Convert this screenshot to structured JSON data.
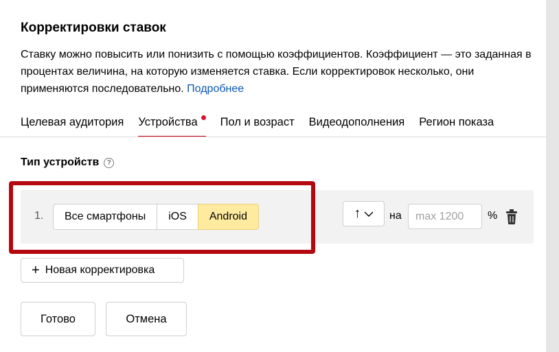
{
  "dialog": {
    "title": "Корректировки ставок",
    "description": "Ставку можно повысить или понизить с помощью коэффициентов. Коэффициент — это заданная в процентах величина, на которую изменяется ставка. Если корректировок несколько, они применяются последовательно.",
    "more_link": "Подробнее"
  },
  "tabs": [
    {
      "label": "Целевая аудитория",
      "active": false
    },
    {
      "label": "Устройства",
      "active": true,
      "has_dot": true
    },
    {
      "label": "Пол и возраст",
      "active": false
    },
    {
      "label": "Видеодополнения",
      "active": false
    },
    {
      "label": "Регион показа",
      "active": false
    }
  ],
  "section": {
    "label": "Тип устройств",
    "help_icon": "question-circle-icon"
  },
  "adjustment_row": {
    "number": "1.",
    "device_options": [
      "Все смартфоны",
      "iOS",
      "Android"
    ],
    "selected_device": "Android",
    "direction_symbol": "↑",
    "direction_icon": "arrow-up-icon",
    "na_label": "на",
    "value": "",
    "value_placeholder": "max 1200",
    "percent_sign": "%",
    "delete_icon": "trash-icon"
  },
  "actions": {
    "new_adjustment": "Новая корректировка",
    "done": "Готово",
    "cancel": "Отмена"
  },
  "colors": {
    "link": "#0a56b4",
    "active_tab_underline": "#d0021b",
    "tab_dot": "#e0102d",
    "selected_segment": "#ffeba0",
    "highlight_frame": "#b3080f",
    "row_background": "#f2f2f2"
  }
}
